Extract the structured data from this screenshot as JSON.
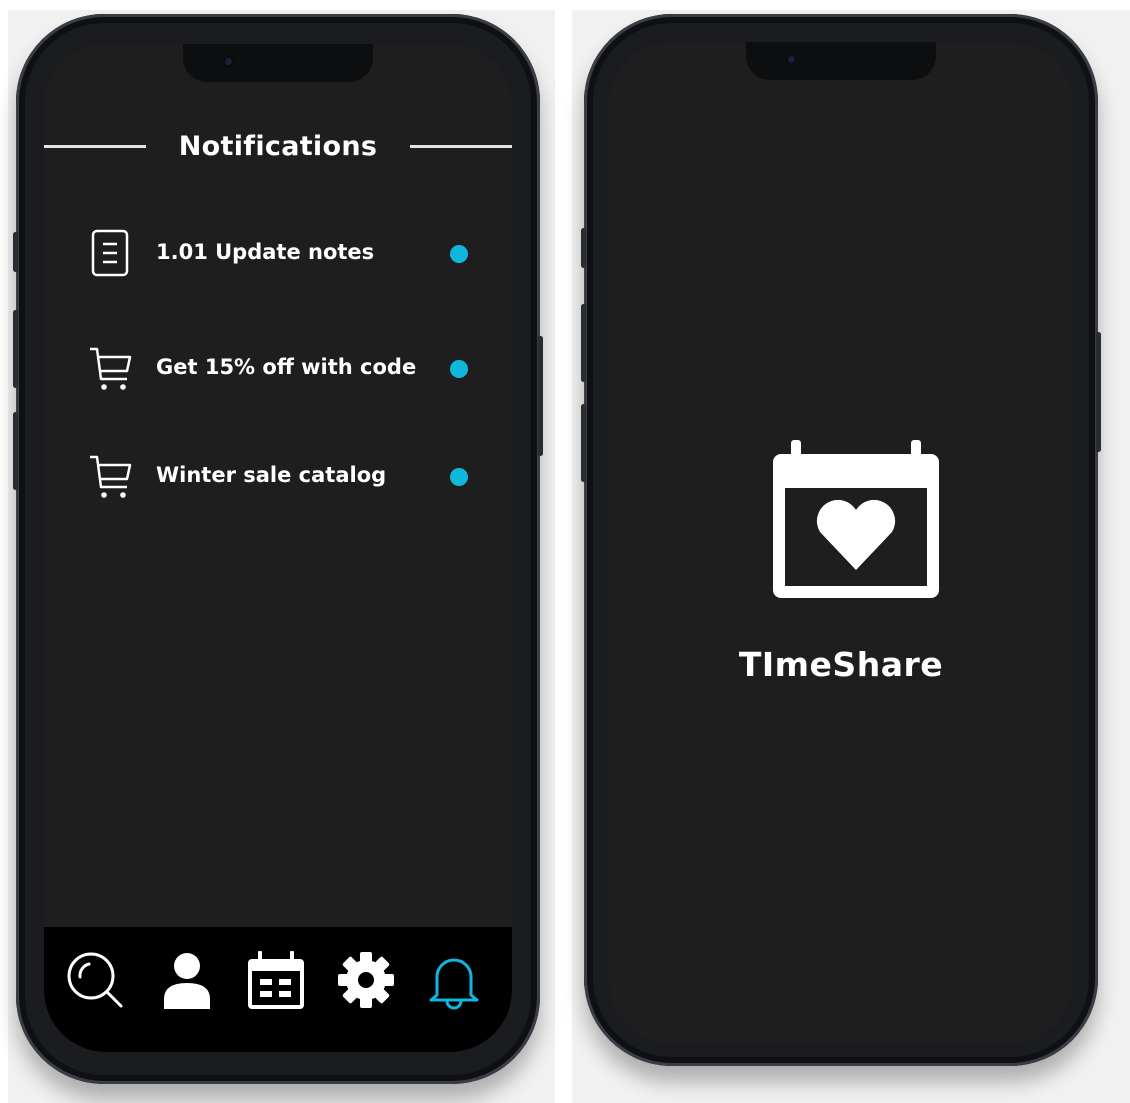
{
  "notifications_screen": {
    "title": "Notifications",
    "items": [
      {
        "label": "1.01 Update notes",
        "icon": "document-icon",
        "unread": true
      },
      {
        "label": "Get 15% off with code",
        "icon": "cart-icon",
        "unread": true
      },
      {
        "label": "Winter sale catalog",
        "icon": "cart-icon",
        "unread": true
      }
    ],
    "tab_bar": {
      "tabs": [
        {
          "name": "search",
          "icon": "search-icon",
          "active": false
        },
        {
          "name": "profile",
          "icon": "user-icon",
          "active": false
        },
        {
          "name": "calendar",
          "icon": "calendar-icon",
          "active": false
        },
        {
          "name": "settings",
          "icon": "gear-icon",
          "active": false
        },
        {
          "name": "notifications",
          "icon": "bell-icon",
          "active": true
        }
      ]
    }
  },
  "splash_screen": {
    "app_name": "TImeShare",
    "logo_icon": "calendar-heart-icon"
  },
  "colors": {
    "screen_background": "#1e1e1e",
    "tab_bar_background": "#000000",
    "accent": "#10b7dd",
    "text": "#ffffff",
    "phone_frame": "#1b1c20",
    "page_background": "#f1f1f1"
  }
}
